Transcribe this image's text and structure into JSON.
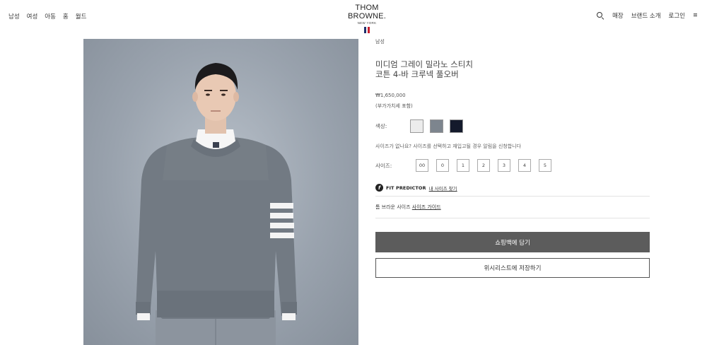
{
  "nav": {
    "left": [
      "남성",
      "여성",
      "아동",
      "홈",
      "월드"
    ],
    "right": [
      "매장",
      "브랜드 소개",
      "로그인"
    ]
  },
  "brand": {
    "name": "THOM BROWNE.",
    "sub": "NEW YORK"
  },
  "product": {
    "breadcrumb": "남성",
    "title_line1": "미디엄 그레이 밀라노 스티치",
    "title_line2": "코튼 4-바 크루넥 풀오버",
    "price": "₩1,650,000",
    "tax_note": "(부가가치세 포함)",
    "color_label": "색상:",
    "colors": [
      {
        "name": "light-gray",
        "hex": "#ececec"
      },
      {
        "name": "medium-gray",
        "hex": "#7d858e"
      },
      {
        "name": "navy",
        "hex": "#141a2c"
      }
    ],
    "size_note": "사이즈가 없나요? 사이즈를 선택하고 재입고될 경우 알림을 신청합니다",
    "size_label": "사이즈:",
    "sizes": [
      "00",
      "0",
      "1",
      "2",
      "3",
      "4",
      "5"
    ],
    "fit_predictor": "FIT PREDICTOR",
    "fit_link": "내 사이즈 찾기",
    "guide_text": "톰 브라운 사이즈",
    "guide_link": "사이즈 가이드",
    "add_to_bag": "쇼핑백에 담기",
    "add_to_wishlist": "위시리스트에 저장하기"
  },
  "colors": {
    "primary_button": "#5c5c5c",
    "background": "#ffffff"
  }
}
